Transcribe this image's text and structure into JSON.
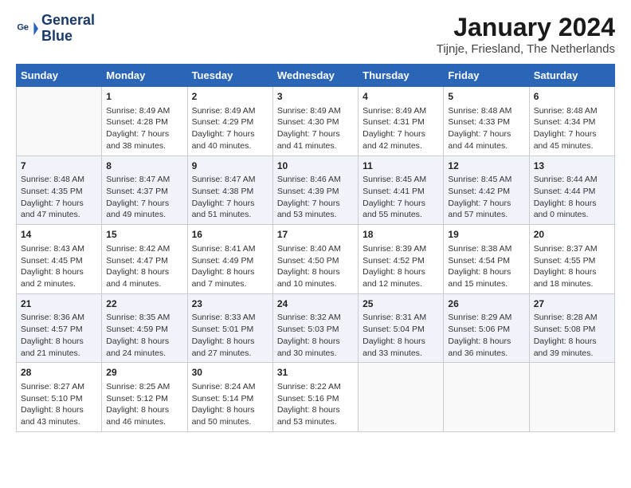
{
  "logo": {
    "line1": "General",
    "line2": "Blue"
  },
  "title": "January 2024",
  "location": "Tijnje, Friesland, The Netherlands",
  "days_header": [
    "Sunday",
    "Monday",
    "Tuesday",
    "Wednesday",
    "Thursday",
    "Friday",
    "Saturday"
  ],
  "weeks": [
    [
      {
        "num": "",
        "info": ""
      },
      {
        "num": "1",
        "info": "Sunrise: 8:49 AM\nSunset: 4:28 PM\nDaylight: 7 hours\nand 38 minutes."
      },
      {
        "num": "2",
        "info": "Sunrise: 8:49 AM\nSunset: 4:29 PM\nDaylight: 7 hours\nand 40 minutes."
      },
      {
        "num": "3",
        "info": "Sunrise: 8:49 AM\nSunset: 4:30 PM\nDaylight: 7 hours\nand 41 minutes."
      },
      {
        "num": "4",
        "info": "Sunrise: 8:49 AM\nSunset: 4:31 PM\nDaylight: 7 hours\nand 42 minutes."
      },
      {
        "num": "5",
        "info": "Sunrise: 8:48 AM\nSunset: 4:33 PM\nDaylight: 7 hours\nand 44 minutes."
      },
      {
        "num": "6",
        "info": "Sunrise: 8:48 AM\nSunset: 4:34 PM\nDaylight: 7 hours\nand 45 minutes."
      }
    ],
    [
      {
        "num": "7",
        "info": "Sunrise: 8:48 AM\nSunset: 4:35 PM\nDaylight: 7 hours\nand 47 minutes."
      },
      {
        "num": "8",
        "info": "Sunrise: 8:47 AM\nSunset: 4:37 PM\nDaylight: 7 hours\nand 49 minutes."
      },
      {
        "num": "9",
        "info": "Sunrise: 8:47 AM\nSunset: 4:38 PM\nDaylight: 7 hours\nand 51 minutes."
      },
      {
        "num": "10",
        "info": "Sunrise: 8:46 AM\nSunset: 4:39 PM\nDaylight: 7 hours\nand 53 minutes."
      },
      {
        "num": "11",
        "info": "Sunrise: 8:45 AM\nSunset: 4:41 PM\nDaylight: 7 hours\nand 55 minutes."
      },
      {
        "num": "12",
        "info": "Sunrise: 8:45 AM\nSunset: 4:42 PM\nDaylight: 7 hours\nand 57 minutes."
      },
      {
        "num": "13",
        "info": "Sunrise: 8:44 AM\nSunset: 4:44 PM\nDaylight: 8 hours\nand 0 minutes."
      }
    ],
    [
      {
        "num": "14",
        "info": "Sunrise: 8:43 AM\nSunset: 4:45 PM\nDaylight: 8 hours\nand 2 minutes."
      },
      {
        "num": "15",
        "info": "Sunrise: 8:42 AM\nSunset: 4:47 PM\nDaylight: 8 hours\nand 4 minutes."
      },
      {
        "num": "16",
        "info": "Sunrise: 8:41 AM\nSunset: 4:49 PM\nDaylight: 8 hours\nand 7 minutes."
      },
      {
        "num": "17",
        "info": "Sunrise: 8:40 AM\nSunset: 4:50 PM\nDaylight: 8 hours\nand 10 minutes."
      },
      {
        "num": "18",
        "info": "Sunrise: 8:39 AM\nSunset: 4:52 PM\nDaylight: 8 hours\nand 12 minutes."
      },
      {
        "num": "19",
        "info": "Sunrise: 8:38 AM\nSunset: 4:54 PM\nDaylight: 8 hours\nand 15 minutes."
      },
      {
        "num": "20",
        "info": "Sunrise: 8:37 AM\nSunset: 4:55 PM\nDaylight: 8 hours\nand 18 minutes."
      }
    ],
    [
      {
        "num": "21",
        "info": "Sunrise: 8:36 AM\nSunset: 4:57 PM\nDaylight: 8 hours\nand 21 minutes."
      },
      {
        "num": "22",
        "info": "Sunrise: 8:35 AM\nSunset: 4:59 PM\nDaylight: 8 hours\nand 24 minutes."
      },
      {
        "num": "23",
        "info": "Sunrise: 8:33 AM\nSunset: 5:01 PM\nDaylight: 8 hours\nand 27 minutes."
      },
      {
        "num": "24",
        "info": "Sunrise: 8:32 AM\nSunset: 5:03 PM\nDaylight: 8 hours\nand 30 minutes."
      },
      {
        "num": "25",
        "info": "Sunrise: 8:31 AM\nSunset: 5:04 PM\nDaylight: 8 hours\nand 33 minutes."
      },
      {
        "num": "26",
        "info": "Sunrise: 8:29 AM\nSunset: 5:06 PM\nDaylight: 8 hours\nand 36 minutes."
      },
      {
        "num": "27",
        "info": "Sunrise: 8:28 AM\nSunset: 5:08 PM\nDaylight: 8 hours\nand 39 minutes."
      }
    ],
    [
      {
        "num": "28",
        "info": "Sunrise: 8:27 AM\nSunset: 5:10 PM\nDaylight: 8 hours\nand 43 minutes."
      },
      {
        "num": "29",
        "info": "Sunrise: 8:25 AM\nSunset: 5:12 PM\nDaylight: 8 hours\nand 46 minutes."
      },
      {
        "num": "30",
        "info": "Sunrise: 8:24 AM\nSunset: 5:14 PM\nDaylight: 8 hours\nand 50 minutes."
      },
      {
        "num": "31",
        "info": "Sunrise: 8:22 AM\nSunset: 5:16 PM\nDaylight: 8 hours\nand 53 minutes."
      },
      {
        "num": "",
        "info": ""
      },
      {
        "num": "",
        "info": ""
      },
      {
        "num": "",
        "info": ""
      }
    ]
  ]
}
